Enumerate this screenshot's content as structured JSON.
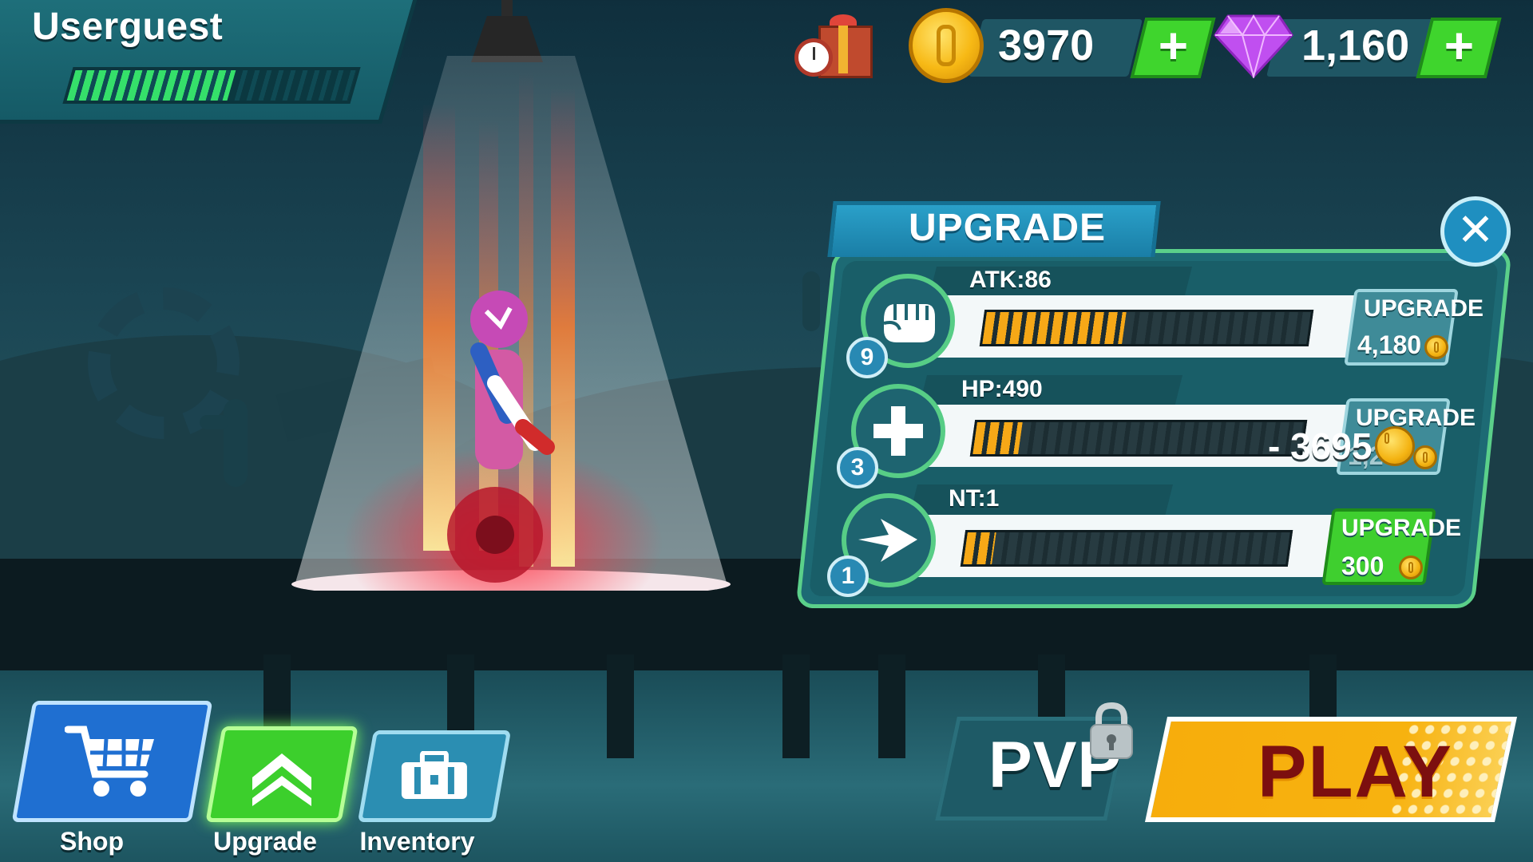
{
  "profile": {
    "username": "Userguest",
    "xp_progress": 0.57
  },
  "currency": {
    "coins": "3970",
    "gems": "1,160",
    "add_label": "+"
  },
  "upgrade_panel": {
    "title": "UPGRADE",
    "close_label": "✕",
    "stats": [
      {
        "label": "ATK:86",
        "level": "9",
        "progress": 0.43,
        "button_label": "UPGRADE",
        "cost": "4,180",
        "affordable": false,
        "icon": "fist-icon"
      },
      {
        "label": "HP:490",
        "level": "3",
        "progress": 0.14,
        "button_label": "UPGRADE",
        "cost": "1,2",
        "affordable": false,
        "icon": "plus-icon"
      },
      {
        "label": "NT:1",
        "level": "1",
        "progress": 0.09,
        "button_label": "UPGRADE",
        "cost": "300",
        "affordable": true,
        "icon": "arrow-icon"
      }
    ],
    "floating_cost": "- 3695"
  },
  "nav": {
    "shop": "Shop",
    "upgrade": "Upgrade",
    "inventory": "Inventory",
    "pvp": "PVP",
    "play": "PLAY"
  },
  "colors": {
    "accent_green": "#3fd52d",
    "coin_gold": "#f7b915",
    "gem_purple": "#c04ff0",
    "play_orange": "#f7ad0c",
    "play_text": "#7c0f0f"
  }
}
